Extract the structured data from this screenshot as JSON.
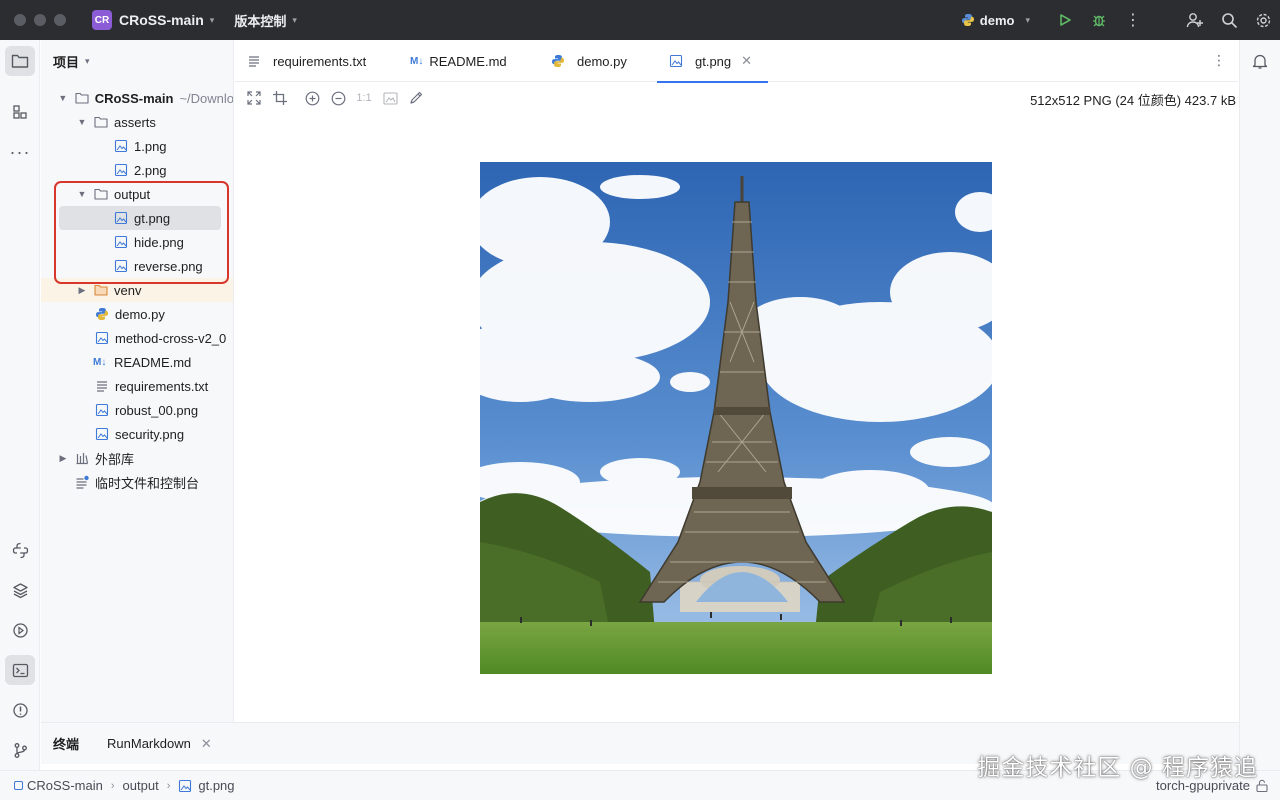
{
  "titlebar": {
    "project_badge": "CR",
    "project_name": "CRoSS-main",
    "vcs_label": "版本控制",
    "run_config": "demo"
  },
  "project_panel": {
    "title": "项目",
    "root": {
      "name": "CRoSS-main",
      "path_hint": "~/Downlo"
    },
    "items": [
      {
        "label": "asserts",
        "type": "folder"
      },
      {
        "label": "1.png",
        "type": "image"
      },
      {
        "label": "2.png",
        "type": "image"
      },
      {
        "label": "output",
        "type": "folder"
      },
      {
        "label": "gt.png",
        "type": "image"
      },
      {
        "label": "hide.png",
        "type": "image"
      },
      {
        "label": "reverse.png",
        "type": "image"
      },
      {
        "label": "venv",
        "type": "folder"
      },
      {
        "label": "demo.py",
        "type": "python"
      },
      {
        "label": "method-cross-v2_0",
        "type": "image"
      },
      {
        "label": "README.md",
        "type": "markdown"
      },
      {
        "label": "requirements.txt",
        "type": "text"
      },
      {
        "label": "robust_00.png",
        "type": "image"
      },
      {
        "label": "security.png",
        "type": "image"
      },
      {
        "label": "外部库",
        "type": "library"
      },
      {
        "label": "临时文件和控制台",
        "type": "scratch"
      }
    ]
  },
  "tabs": [
    {
      "label": "requirements.txt",
      "icon": "text-file-icon"
    },
    {
      "label": "README.md",
      "icon": "markdown-icon"
    },
    {
      "label": "demo.py",
      "icon": "python-icon"
    },
    {
      "label": "gt.png",
      "icon": "image-file-icon",
      "active": true
    }
  ],
  "image_toolbar": {
    "actual_size_label": "1:1",
    "info": "512x512 PNG (24 位颜色) 423.7 kB"
  },
  "bottom_tabs": [
    {
      "label": "终端"
    },
    {
      "label": "RunMarkdown"
    }
  ],
  "statusbar": {
    "breadcrumbs": [
      "CRoSS-main",
      "output",
      "gt.png"
    ],
    "interpreter": "torch-gpuprivate"
  },
  "watermark": "掘金技术社区 @ 程序猿追",
  "colors": {
    "accent": "#3574f0",
    "highlight_box": "#d9362b",
    "titlebar_bg": "#2b2d30",
    "project_badge": "#8b5cd6"
  }
}
